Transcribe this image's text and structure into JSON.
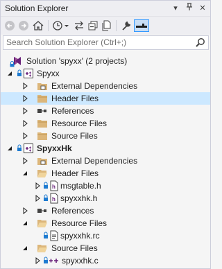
{
  "window": {
    "title": "Solution Explorer",
    "title_buttons": {
      "dropdown": "▾",
      "pin": "⊥",
      "close": "✕"
    }
  },
  "toolbar": {
    "buttons": [
      "back-arrow-icon",
      "forward-arrow-icon",
      "home-icon",
      "history-icon",
      "sync-icon",
      "collapse-all-icon",
      "copy-icon",
      "properties-wrench-icon",
      "preview-toggle-icon"
    ]
  },
  "search": {
    "placeholder": "Search Solution Explorer (Ctrl+;)"
  },
  "colors": {
    "selection": "#cce8ff",
    "folder": "#dcb67a",
    "vs_purple": "#68217a",
    "lock_blue": "#1e7bd1"
  },
  "tree": {
    "solution": "Solution 'spyxx' (2 projects)",
    "projects": [
      {
        "name": "Spyxx",
        "bold": false,
        "children": [
          {
            "label": "External Dependencies",
            "expanded": false,
            "selected": false
          },
          {
            "label": "Header Files",
            "expanded": false,
            "selected": true
          },
          {
            "label": "References",
            "expanded": false,
            "selected": false
          },
          {
            "label": "Resource Files",
            "expanded": false,
            "selected": false
          },
          {
            "label": "Source Files",
            "expanded": false,
            "selected": false
          }
        ]
      },
      {
        "name": "SpyxxHk",
        "bold": true,
        "children": [
          {
            "label": "External Dependencies",
            "expanded": false
          },
          {
            "label": "Header Files",
            "expanded": true,
            "files": [
              "msgtable.h",
              "spyxxhk.h"
            ]
          },
          {
            "label": "References",
            "expanded": false
          },
          {
            "label": "Resource Files",
            "expanded": true,
            "files": [
              "spyxxhk.rc"
            ]
          },
          {
            "label": "Source Files",
            "expanded": true,
            "files": [
              "spyxxhk.c"
            ]
          }
        ]
      }
    ]
  }
}
